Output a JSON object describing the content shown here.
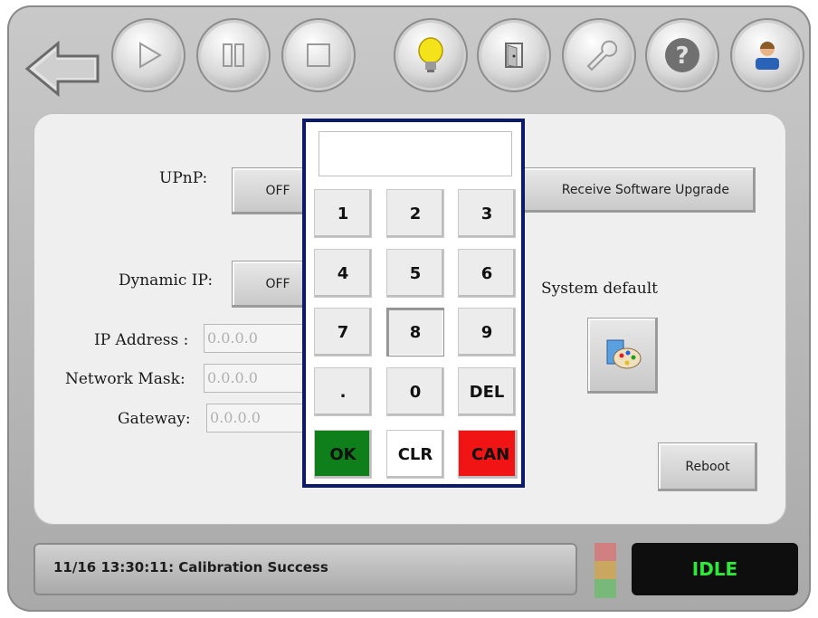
{
  "toolbar": {
    "items": [
      "back-arrow-icon",
      "play-icon",
      "pause-icon",
      "stop-icon",
      "lightbulb-icon",
      "door-icon",
      "wrench-icon",
      "help-icon",
      "user-icon"
    ]
  },
  "settings": {
    "upnp_label": "UPnP:",
    "upnp_value": "OFF",
    "dynamic_ip_label": "Dynamic IP:",
    "dynamic_ip_value": "OFF",
    "receive_upgrade_label": "Receive Software Upgrade",
    "ip_address_label": "IP Address :",
    "ip_address_value": "0.0.0.0",
    "network_mask_label": "Network Mask:",
    "network_mask_value": "0.0.0.0",
    "gateway_label": "Gateway:",
    "gateway_value": "0.0.0.0",
    "system_default_label": "System default",
    "reboot_label": "Reboot"
  },
  "keypad": {
    "display_value": "",
    "keys": [
      "1",
      "2",
      "3",
      "4",
      "5",
      "6",
      "7",
      "8",
      "9",
      ".",
      "0",
      "DEL"
    ],
    "ok_label": "OK",
    "clr_label": "CLR",
    "can_label": "CAN",
    "colors": {
      "ok": "#0f7f1c",
      "can": "#f01414",
      "border": "#0b1a6b"
    }
  },
  "status": {
    "message": "11/16 13:30:11: Calibration Success",
    "state": "IDLE",
    "state_color": "#2ee83a"
  }
}
